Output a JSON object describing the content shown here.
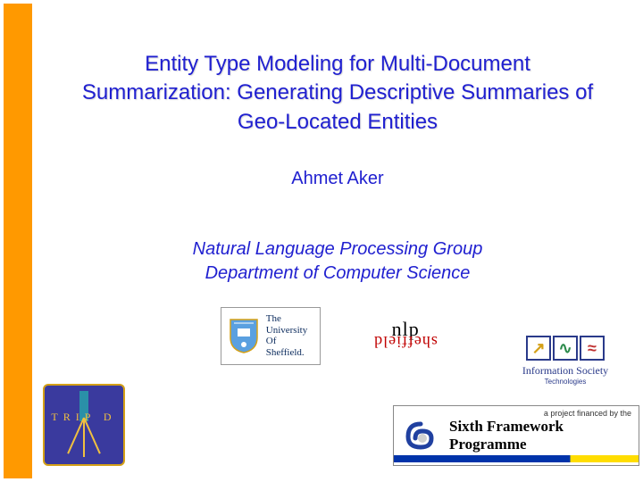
{
  "title": "Entity Type Modeling for Multi-Document Summarization: Generating Descriptive Summaries of Geo-Located Entities",
  "author": "Ahmet Aker",
  "affiliation": {
    "line1": "Natural Language Processing Group",
    "line2": "Department of Computer Science"
  },
  "uos": {
    "l1": "The",
    "l2": "University",
    "l3": "Of",
    "l4": "Sheffield."
  },
  "nlp": {
    "top": "nlp",
    "bottom": "sheffield"
  },
  "tripod": {
    "text": "TRIP D"
  },
  "ist": {
    "caption": "Information Society",
    "sub": "Technologies"
  },
  "fp6": {
    "tag": "a project financed by the",
    "title": "Sixth Framework Programme"
  }
}
